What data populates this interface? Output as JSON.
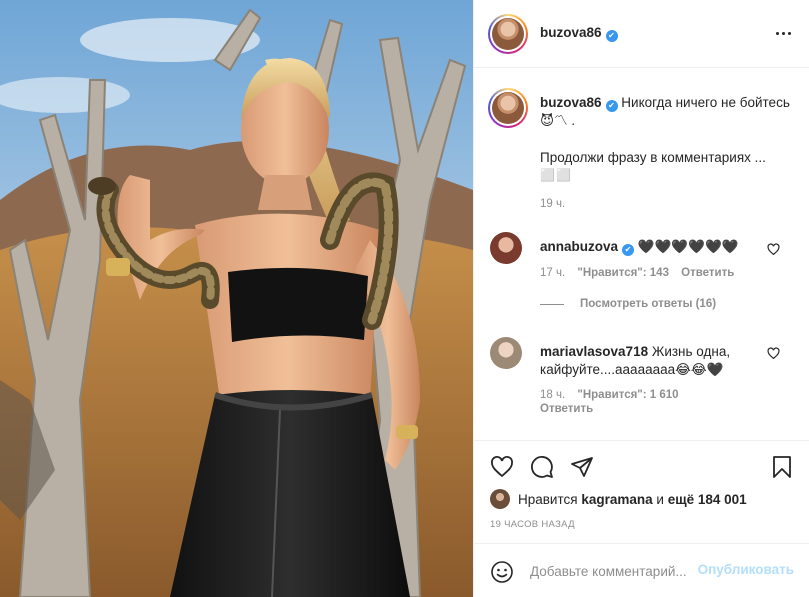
{
  "header": {
    "username": "buzova86",
    "verified_mark": "✔",
    "more_icon": "more-horizontal-icon"
  },
  "caption": {
    "username": "buzova86",
    "text": "Никогда ничего не бойтесь 😈〽 .",
    "line2": "Продолжи фразу в комментариях ...",
    "line3": "⬜⬜",
    "time": "19 ч."
  },
  "comments": [
    {
      "username": "annabuzova",
      "text": "🖤🖤🖤🖤🖤🖤",
      "time": "17 ч.",
      "likes": "\"Нравится\": 143",
      "reply": "Ответить",
      "view_replies": "Посмотреть ответы (16)"
    },
    {
      "username": "mariavlasova718",
      "text": "Жизнь одна, кайфуйте....аааааааа😂😂🖤",
      "time": "18 ч.",
      "likes": "\"Нравится\": 1 610",
      "reply": "Ответить"
    }
  ],
  "actions": {
    "icons": [
      "heart-icon",
      "comment-icon",
      "share-icon",
      "bookmark-icon"
    ],
    "liked_prefix": "Нравится",
    "liked_by": "kagramana",
    "liked_and": "и",
    "liked_rest": "ещё 184 001",
    "posted": "19 ЧАСОВ НАЗАД"
  },
  "add_comment": {
    "placeholder": "Добавьте комментарий...",
    "publish": "Опубликовать"
  },
  "colors": {
    "verified": "#3897f0",
    "publish_disabled": "#b2dffc",
    "muted": "#8e8e8e",
    "border": "#efefef"
  }
}
